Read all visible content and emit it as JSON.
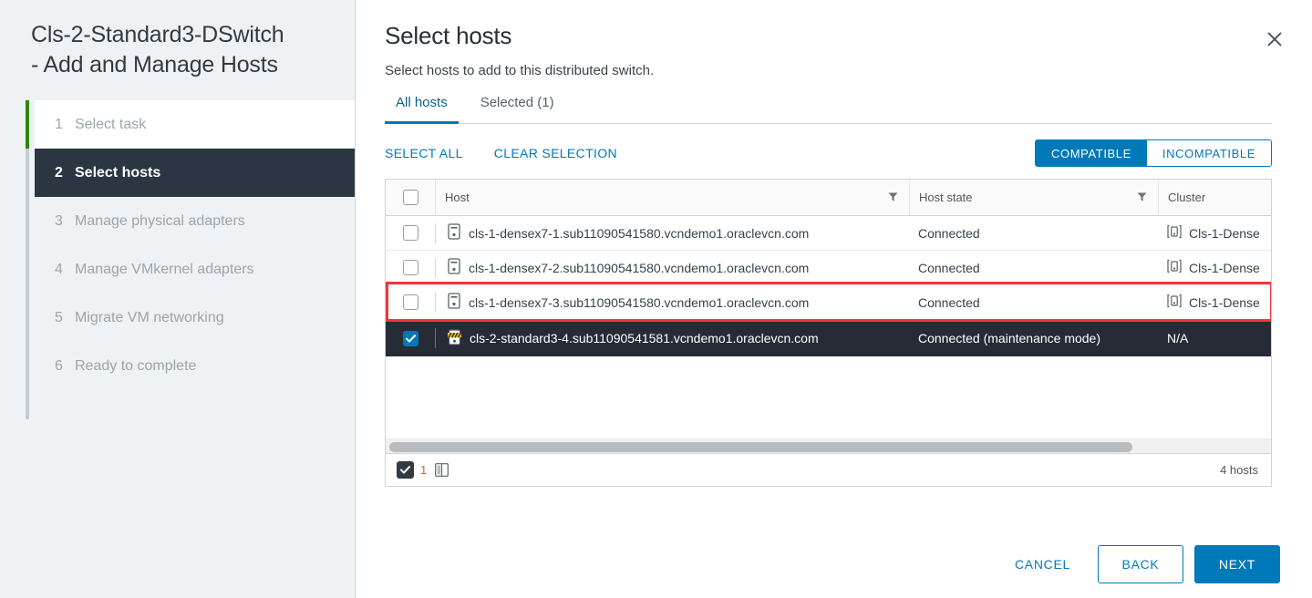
{
  "wizard": {
    "title": "Cls-2-Standard3-DSwitch\n- Add and Manage Hosts",
    "steps": [
      {
        "num": "1",
        "label": "Select task",
        "state": "done"
      },
      {
        "num": "2",
        "label": "Select hosts",
        "state": "active"
      },
      {
        "num": "3",
        "label": "Manage physical adapters",
        "state": "upcoming"
      },
      {
        "num": "4",
        "label": "Manage VMkernel adapters",
        "state": "upcoming"
      },
      {
        "num": "5",
        "label": "Migrate VM networking",
        "state": "upcoming"
      },
      {
        "num": "6",
        "label": "Ready to complete",
        "state": "upcoming"
      }
    ]
  },
  "page": {
    "title": "Select hosts",
    "subtitle": "Select hosts to add to this distributed switch.",
    "close_icon": "close-icon"
  },
  "tabs": [
    {
      "label": "All hosts",
      "active": true
    },
    {
      "label": "Selected (1)",
      "active": false
    }
  ],
  "toolbar": {
    "select_all": "SELECT ALL",
    "clear_selection": "CLEAR SELECTION",
    "compatible": "COMPATIBLE",
    "incompatible": "INCOMPATIBLE",
    "compatible_selected": true
  },
  "table": {
    "columns": [
      "Host",
      "Host state",
      "Cluster"
    ],
    "rows": [
      {
        "checked": false,
        "host_icon": "host-icon",
        "host": "cls-1-densex7-1.sub11090541580.vcndemo1.oraclevcn.com",
        "state": "Connected",
        "cluster_icon": "cluster-icon",
        "cluster": "Cls-1-Dense"
      },
      {
        "checked": false,
        "host_icon": "host-icon",
        "host": "cls-1-densex7-2.sub11090541580.vcndemo1.oraclevcn.com",
        "state": "Connected",
        "cluster_icon": "cluster-icon",
        "cluster": "Cls-1-Dense"
      },
      {
        "checked": false,
        "host_icon": "host-icon",
        "host": "cls-1-densex7-3.sub11090541580.vcndemo1.oraclevcn.com",
        "state": "Connected",
        "cluster_icon": "cluster-icon",
        "cluster": "Cls-1-Dense"
      },
      {
        "checked": true,
        "host_icon": "host-maintenance-icon",
        "host": "cls-2-standard3-4.sub11090541581.vcndemo1.oraclevcn.com",
        "state": "Connected (maintenance mode)",
        "cluster_icon": "",
        "cluster": "N/A"
      }
    ],
    "footer": {
      "selected_count": "1",
      "total": "4 hosts",
      "columns_icon": "columns-icon"
    }
  },
  "buttons": {
    "cancel": "CANCEL",
    "back": "BACK",
    "next": "NEXT"
  },
  "colors": {
    "accent": "#0079b8",
    "step_done": "#318700",
    "step_active_bg": "#2b3642",
    "selected_row_bg": "#252c36",
    "highlight": "#f5333f",
    "count_orange": "#c8700a"
  }
}
